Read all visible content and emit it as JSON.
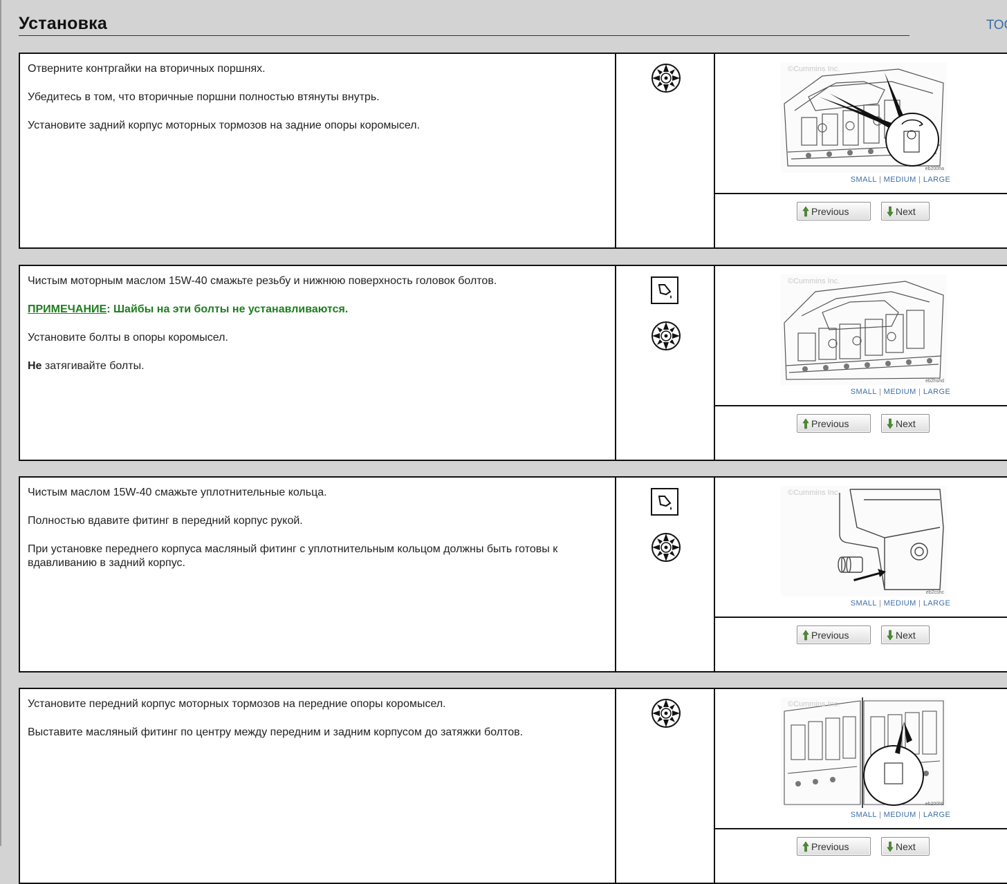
{
  "page": {
    "title": "Установка",
    "toc_link": "ТОС"
  },
  "figure_controls": {
    "small": "SMALL",
    "medium": "MEDIUM",
    "large": "LARGE",
    "separator": "|"
  },
  "nav": {
    "previous": "Previous",
    "next": "Next"
  },
  "figures": {
    "watermark": "©Cummins Inc.",
    "captions": [
      "eb200ha",
      "eb2hshd",
      "eb2cshc",
      "eb200hb"
    ]
  },
  "steps": [
    {
      "paragraphs": [
        "Отверните контргайки на вторичных поршнях.",
        "Убедитесь в том, что вторичные поршни полностью втянуты внутрь.",
        "Установите задний корпус моторных тормозов на задние опоры коромысел."
      ],
      "icons": [
        "tools-icon"
      ]
    },
    {
      "paragraph1": "Чистым моторным маслом 15W-40 смажьте резьбу и нижнюю поверхность головок болтов.",
      "note_label": "ПРИМЕЧАНИЕ",
      "note_text": ": Шайбы на эти болты не устанавливаются.",
      "paragraph3": "Установите болты в опоры коромысел.",
      "bold_word": "Не",
      "paragraph4_rest": " затягивайте болты.",
      "icons": [
        "lubricate-icon",
        "tools-icon"
      ]
    },
    {
      "paragraphs": [
        "Чистым маслом 15W-40 смажьте уплотнительные кольца.",
        "Полностью вдавите фитинг в передний корпус рукой.",
        "При установке переднего корпуса масляный фитинг с уплотнительным кольцом должны быть готовы к вдавливанию в задний корпус."
      ],
      "icons": [
        "lubricate-icon",
        "tools-icon"
      ]
    },
    {
      "paragraphs": [
        "Установите передний корпус моторных тормозов на передние опоры коромысел.",
        "Выставите масляный фитинг по центру между передним и задним корпусом до затяжки болтов."
      ],
      "icons": [
        "tools-icon"
      ]
    }
  ],
  "colors": {
    "note_green": "#1e7d1e",
    "link_blue": "#3b6ea8",
    "page_gray": "#d3d3d3"
  }
}
